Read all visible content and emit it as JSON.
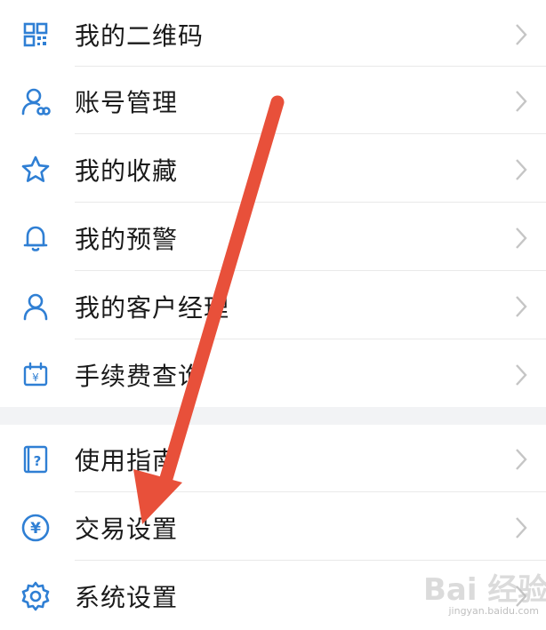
{
  "menu_group_1": [
    {
      "label": "我的二维码",
      "icon": "qr-code-icon"
    },
    {
      "label": "账号管理",
      "icon": "account-link-icon"
    },
    {
      "label": "我的收藏",
      "icon": "star-icon"
    },
    {
      "label": "我的预警",
      "icon": "bell-icon"
    },
    {
      "label": "我的客户经理",
      "icon": "person-icon"
    },
    {
      "label": "手续费查询",
      "icon": "calendar-yen-icon"
    }
  ],
  "menu_group_2": [
    {
      "label": "使用指南",
      "icon": "guide-book-icon"
    },
    {
      "label": "交易设置",
      "icon": "yen-circle-icon"
    },
    {
      "label": "系统设置",
      "icon": "gear-icon"
    }
  ],
  "watermark": {
    "text": "Bai 经验",
    "url": "jingyan.baidu.com"
  },
  "colors": {
    "icon": "#2f7fd4",
    "chevron": "#c5c5c5",
    "arrow": "#e8503a",
    "divider": "#e9e9e9",
    "gap": "#f2f3f5"
  }
}
